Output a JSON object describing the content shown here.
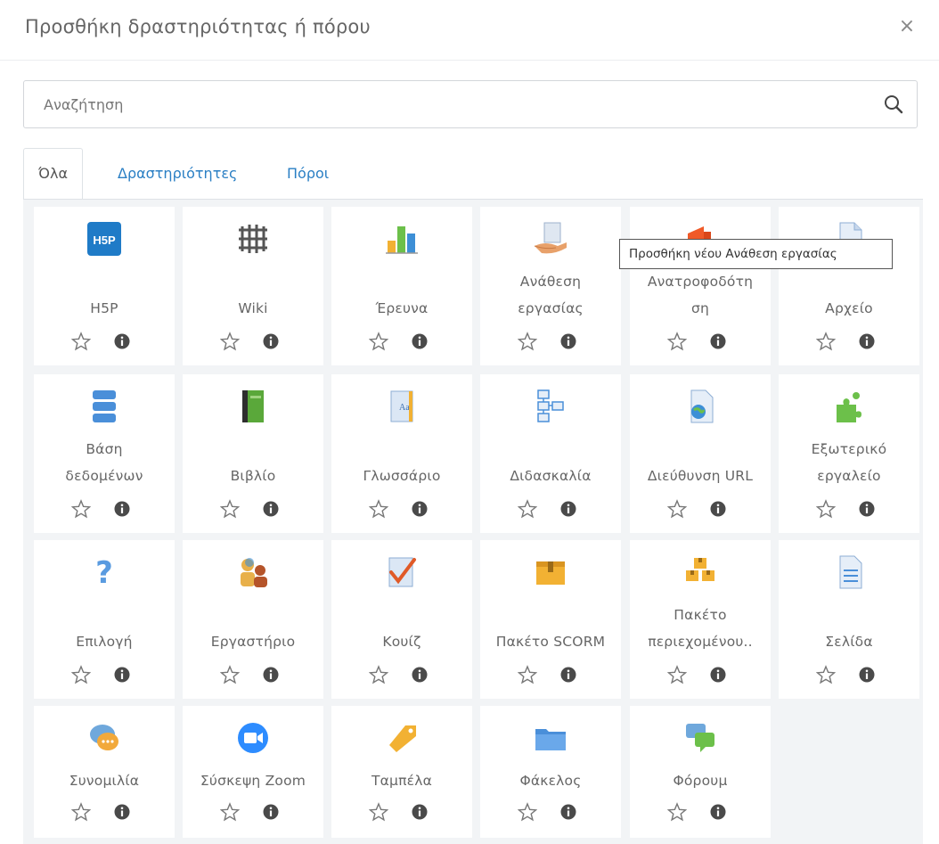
{
  "modal": {
    "title": "Προσθήκη δραστηριότητας ή πόρου",
    "close_symbol": "×"
  },
  "search": {
    "placeholder": "Αναζήτηση",
    "value": ""
  },
  "tabs": [
    {
      "label": "Όλα",
      "active": true
    },
    {
      "label": "Δραστηριότητες",
      "active": false
    },
    {
      "label": "Πόροι",
      "active": false
    }
  ],
  "tooltip": {
    "text": "Προσθήκη νέου Ανάθεση εργασίας"
  },
  "items": [
    {
      "lines": [
        "H5P"
      ],
      "icon": "h5p-icon"
    },
    {
      "lines": [
        "Wiki"
      ],
      "icon": "wiki-icon"
    },
    {
      "lines": [
        "Έρευνα"
      ],
      "icon": "survey-icon"
    },
    {
      "lines": [
        "Ανάθεση",
        "εργασίας"
      ],
      "icon": "assignment-icon"
    },
    {
      "lines": [
        "Ανατροφοδότη",
        "ση"
      ],
      "icon": "feedback-icon"
    },
    {
      "lines": [
        "Αρχείο"
      ],
      "icon": "file-icon"
    },
    {
      "lines": [
        "Βάση",
        "δεδομένων"
      ],
      "icon": "database-icon"
    },
    {
      "lines": [
        "Βιβλίο"
      ],
      "icon": "book-icon"
    },
    {
      "lines": [
        "Γλωσσάριο"
      ],
      "icon": "glossary-icon"
    },
    {
      "lines": [
        "Διδασκαλία"
      ],
      "icon": "lesson-icon"
    },
    {
      "lines": [
        "Διεύθυνση URL"
      ],
      "icon": "url-icon"
    },
    {
      "lines": [
        "Εξωτερικό",
        "εργαλείο"
      ],
      "icon": "external-tool-icon"
    },
    {
      "lines": [
        "Επιλογή"
      ],
      "icon": "choice-icon"
    },
    {
      "lines": [
        "Εργαστήριο"
      ],
      "icon": "workshop-icon"
    },
    {
      "lines": [
        "Κουίζ"
      ],
      "icon": "quiz-icon"
    },
    {
      "lines": [
        "Πακέτο SCORM"
      ],
      "icon": "scorm-icon"
    },
    {
      "lines": [
        "Πακέτο",
        "περιεχομένου.."
      ],
      "icon": "content-package-icon"
    },
    {
      "lines": [
        "Σελίδα"
      ],
      "icon": "page-icon"
    },
    {
      "lines": [
        "Συνομιλία"
      ],
      "icon": "chat-icon"
    },
    {
      "lines": [
        "Σύσκεψη Zoom"
      ],
      "icon": "zoom-icon"
    },
    {
      "lines": [
        "Ταμπέλα"
      ],
      "icon": "label-icon"
    },
    {
      "lines": [
        "Φάκελος"
      ],
      "icon": "folder-icon"
    },
    {
      "lines": [
        "Φόρουμ"
      ],
      "icon": "forum-icon"
    }
  ],
  "colors": {
    "accent": "#2a7fc4",
    "grid_bg": "#f2f4f6",
    "card_bg": "#ffffff"
  }
}
